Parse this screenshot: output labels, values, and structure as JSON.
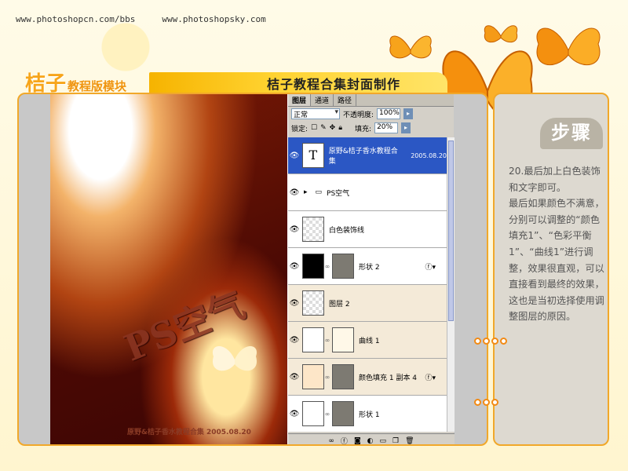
{
  "header": {
    "url1": "www.photoshopcn.com/bbs",
    "url2": "www.photoshopsky.com",
    "brand_big": "桔子",
    "brand_small": "教程版模块",
    "page_title": "桔子教程合集封面制作"
  },
  "artwork": {
    "text": "PS空气",
    "footer": "原野&桔子香水教程合集    2005.08.20"
  },
  "photoshop_panel": {
    "tabs": [
      {
        "label": "图层"
      },
      {
        "label": "通道"
      },
      {
        "label": "路径"
      }
    ],
    "blend_mode": "正常",
    "opacity_label": "不透明度:",
    "opacity_value": "100%",
    "lock_label": "锁定:",
    "fill_label": "填充:",
    "fill_value": "20%",
    "layers": [
      {
        "name": "原野&桔子香水教程合集",
        "date": "2005.08.20",
        "thumb": "T"
      },
      {
        "name": "PS空气"
      },
      {
        "name": "白色装饰线"
      },
      {
        "name": "形状 2"
      },
      {
        "name": "图层 2"
      },
      {
        "name": "曲线 1"
      },
      {
        "name": "颜色填充 1 副本 4"
      },
      {
        "name": "形状 1"
      }
    ],
    "footer_icons": [
      "link-icon",
      "fx-icon",
      "mask-icon",
      "adjustment-icon",
      "folder-icon",
      "new-layer-icon",
      "trash-icon"
    ]
  },
  "steps": {
    "badge": "步骤",
    "paragraph1": "20.最后加上白色装饰和文字即可。",
    "paragraph2": "最后如果颜色不满意，分别可以调整的“颜色填充1”、“色彩平衡1”、“曲线1”进行调整，效果很直观，可以直接看到最终的效果，这也是当初选择使用调整图层的原因。"
  },
  "colors": {
    "accent": "#f1a82a",
    "title_band": "#ffd22f",
    "selected_layer": "#2b57c4"
  }
}
